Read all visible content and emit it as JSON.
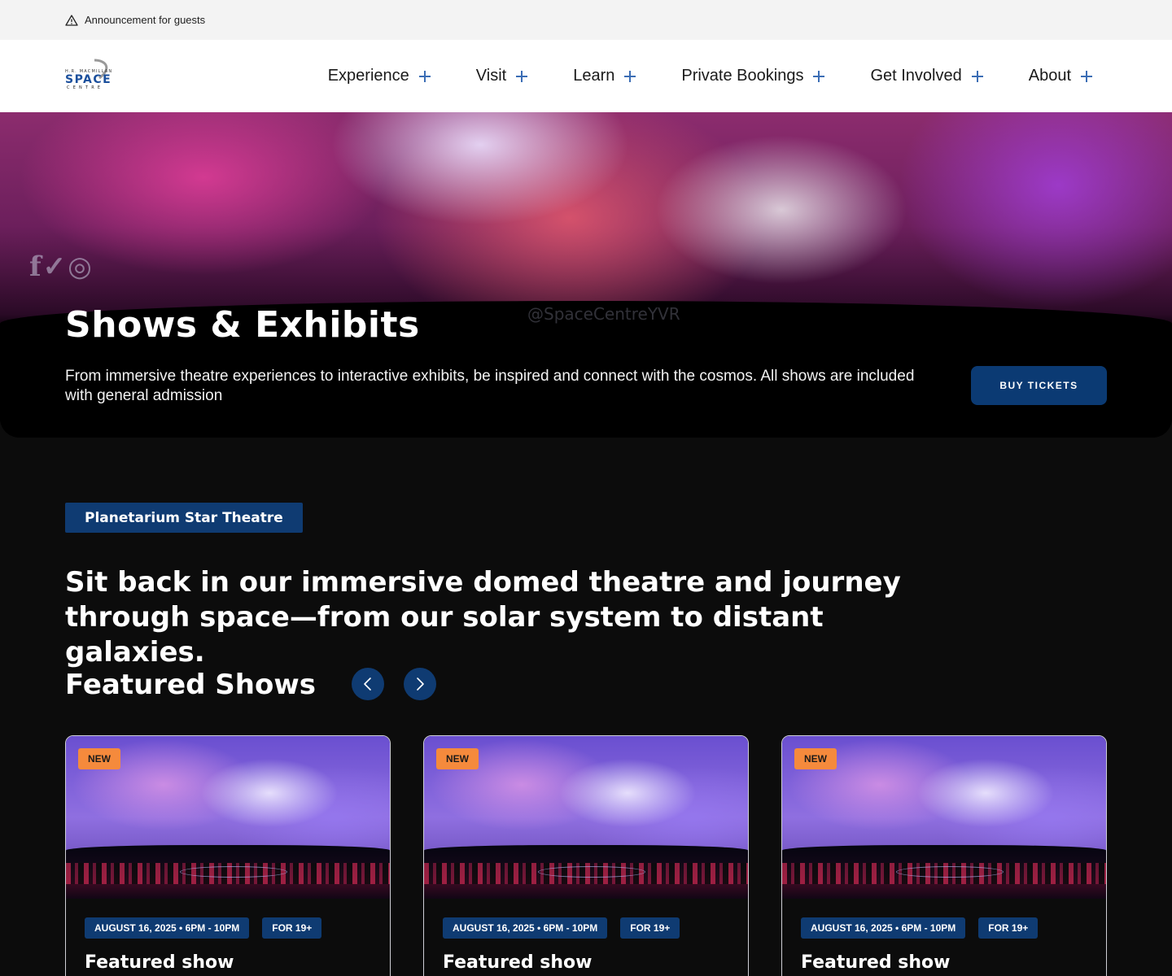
{
  "announcement": {
    "text": "Announcement for guests"
  },
  "logo": {
    "top_text": "H.R. MACMILLAN",
    "main": "SPACE",
    "sub": "CENTRE"
  },
  "nav": {
    "items": [
      {
        "label": "Experience"
      },
      {
        "label": "Visit"
      },
      {
        "label": "Learn"
      },
      {
        "label": "Private Bookings"
      },
      {
        "label": "Get Involved"
      },
      {
        "label": "About"
      }
    ]
  },
  "hero": {
    "title": "Shows & Exhibits",
    "description": "From immersive theatre experiences to interactive exhibits, be inspired and connect with the cosmos. All shows are included with general admission",
    "button": "BUY TICKETS",
    "handle": "@SpaceCentreYVR"
  },
  "section": {
    "tag": "Planetarium Star Theatre",
    "intro": "Sit back in our immersive domed theatre and journey through space—from our solar system to distant galaxies.",
    "featured_title": "Featured Shows"
  },
  "cards": [
    {
      "badge": "NEW",
      "date": "AUGUST 16, 2025 • 6PM - 10PM",
      "age": "FOR 19+",
      "title": "Featured show"
    },
    {
      "badge": "NEW",
      "date": "AUGUST 16, 2025 • 6PM - 10PM",
      "age": "FOR 19+",
      "title": "Featured show"
    },
    {
      "badge": "NEW",
      "date": "AUGUST 16, 2025 • 6PM - 10PM",
      "age": "FOR 19+",
      "title": "Featured show"
    }
  ],
  "colors": {
    "brand_blue": "#0f3b72",
    "accent_orange": "#f58a3c",
    "nav_plus": "#3b6db5"
  }
}
